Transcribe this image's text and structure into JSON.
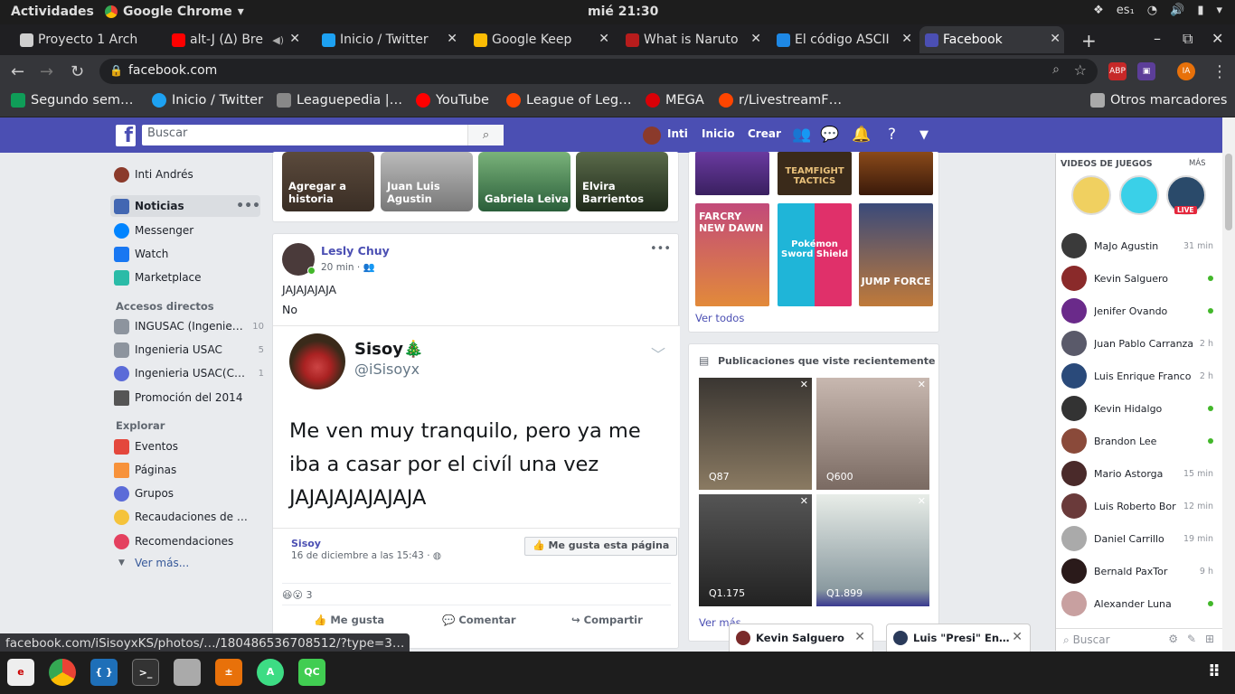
{
  "gnome": {
    "activities": "Actividades",
    "app": "Google Chrome",
    "clock": "mié 21:30",
    "lang": "es₁"
  },
  "tabs": [
    {
      "label": "Proyecto 1 Arch",
      "color": "#cfcfcf"
    },
    {
      "label": "alt-J (Δ) Bre",
      "color": "#ff0000"
    },
    {
      "label": "Inicio / Twitter",
      "color": "#1da1f2"
    },
    {
      "label": "Google Keep",
      "color": "#fbbc04"
    },
    {
      "label": "What is Naruto",
      "color": "#b71c1c"
    },
    {
      "label": "El código ASCII",
      "color": "#1e88e5"
    },
    {
      "label": "Facebook",
      "color": "#4b4fb3"
    }
  ],
  "url": "facebook.com",
  "bookmarks": [
    "Segundo sem…",
    "Inicio / Twitter",
    "Leaguepedia |…",
    "YouTube",
    "League of Leg…",
    "MEGA",
    "r/LivestreamF…",
    "Otros marcadores"
  ],
  "fb": {
    "search_placeholder": "Buscar",
    "user": "Inti",
    "home": "Inicio",
    "create": "Crear"
  },
  "left": {
    "profile": "Inti Andrés",
    "items": [
      {
        "label": "Noticias"
      },
      {
        "label": "Messenger"
      },
      {
        "label": "Watch"
      },
      {
        "label": "Marketplace"
      }
    ],
    "shortcuts_title": "Accesos directos",
    "shortcuts": [
      {
        "label": "INGUSAC (Ingenie…",
        "count": "10"
      },
      {
        "label": "Ingenieria USAC",
        "count": "5"
      },
      {
        "label": "Ingenieria USAC(C…",
        "count": "1"
      },
      {
        "label": "Promoción del 2014",
        "count": ""
      }
    ],
    "explore_title": "Explorar",
    "explore": [
      {
        "label": "Eventos"
      },
      {
        "label": "Páginas"
      },
      {
        "label": "Grupos"
      },
      {
        "label": "Recaudaciones de …"
      },
      {
        "label": "Recomendaciones"
      }
    ],
    "more": "Ver más..."
  },
  "stories": [
    {
      "label": "Agregar a historia"
    },
    {
      "label": "Juan Luis Agustin"
    },
    {
      "label": "Gabriela Leiva"
    },
    {
      "label": "Elvira Barrientos"
    }
  ],
  "post": {
    "author": "Lesly Chuy",
    "time": "20 min ·",
    "text1": "JAJAJAJAJA",
    "text2": "No",
    "tweet_name": "Sisoy🎄",
    "tweet_handle": "@iSisoyx",
    "tweet_text": "Me ven muy tranquilo, pero ya me iba a casar por el civíl una vez JAJAJAJAJAJAJA",
    "page": "Sisoy",
    "page_date": "16 de diciembre a las 15:43 ·",
    "like_page": "Me gusta esta página",
    "reactions": "3",
    "like": "Me gusta",
    "comment": "Comentar",
    "share": "Compartir"
  },
  "games": {
    "tiles": [
      "",
      "TEAMFIGHT TACTICS",
      "",
      "FARCRY NEW DAWN",
      "Pokémon Sword Shield",
      "JUMP FORCE"
    ],
    "see_all": "Ver todos"
  },
  "recent": {
    "title": "Publicaciones que viste recientemente",
    "prices": [
      "Q87",
      "Q600",
      "Q1.175",
      "Q1.899"
    ],
    "more": "Ver más"
  },
  "chat": {
    "title": "VIDEOS DE JUEGOS",
    "more": "MÁS",
    "live": "LIVE",
    "users": [
      {
        "name": "MaJo Agustin",
        "time": "31 min"
      },
      {
        "name": "Kevin Salguero",
        "time": ""
      },
      {
        "name": "Jenifer Ovando",
        "time": ""
      },
      {
        "name": "Juan Pablo Carranza",
        "time": "2 h"
      },
      {
        "name": "Luis Enrique Franco …",
        "time": "2 h"
      },
      {
        "name": "Kevin Hidalgo",
        "time": ""
      },
      {
        "name": "Brandon Lee",
        "time": ""
      },
      {
        "name": "Mario Astorga",
        "time": "15 min"
      },
      {
        "name": "Luis Roberto Boror",
        "time": "12 min"
      },
      {
        "name": "Daniel Carrillo",
        "time": "19 min"
      },
      {
        "name": "Bernald PaxTor",
        "time": "9 h"
      },
      {
        "name": "Alexander Luna",
        "time": ""
      }
    ],
    "search": "Buscar"
  },
  "chat_tabs": [
    "Kevin Salguero",
    "Luis \"Presi\" En…"
  ],
  "status_url": "facebook.com/iSisoyxKS/photos/…/180486536708512/?type=3…"
}
